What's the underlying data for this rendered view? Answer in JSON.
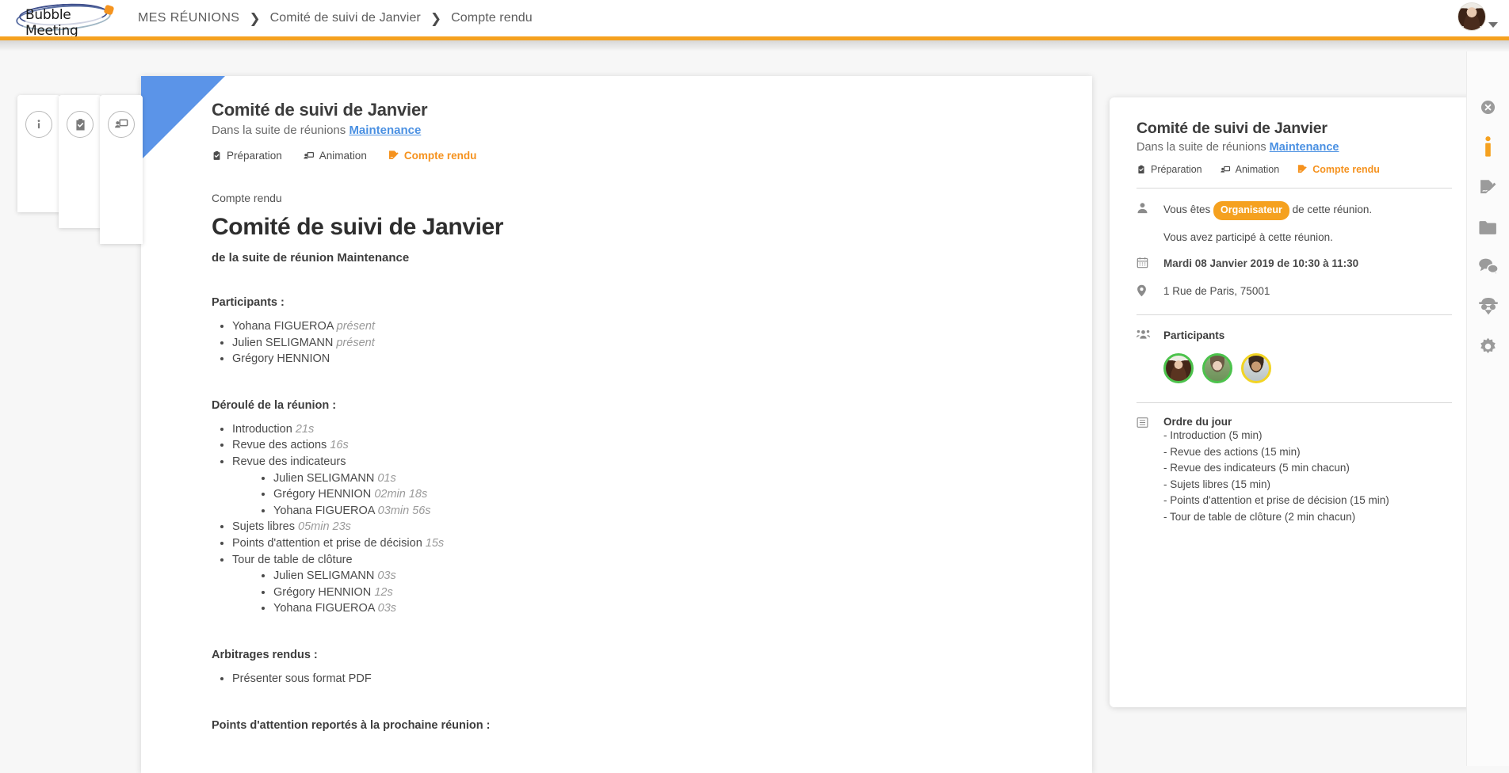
{
  "app": {
    "logo_text": "Bubble Meeting",
    "accent_orange": "#f5a11f",
    "accent_blue": "#4a90e2",
    "corner_blue": "#5b94e8"
  },
  "breadcrumb": {
    "items": [
      {
        "label": "MES RÉUNIONS"
      },
      {
        "label": "Comité de suivi de Janvier"
      },
      {
        "label": "Compte rendu"
      }
    ],
    "separator": "❯"
  },
  "header": {
    "avatar_name": "avatar",
    "caret": "caret-down-icon"
  },
  "left_tabs": [
    {
      "icon": "info-icon",
      "name": "sidebar-tab-info"
    },
    {
      "icon": "clipboard-check-icon",
      "name": "sidebar-tab-preparation"
    },
    {
      "icon": "presentation-icon",
      "name": "sidebar-tab-animation"
    }
  ],
  "document": {
    "card_title": "Comité de suivi de Janvier",
    "card_subtitle_prefix": "Dans la suite de réunions ",
    "card_subtitle_link": "Maintenance",
    "tabs": [
      {
        "label": "Préparation",
        "icon": "clipboard-check-icon",
        "active": false
      },
      {
        "label": "Animation",
        "icon": "presentation-icon",
        "active": false
      },
      {
        "label": "Compte rendu",
        "icon": "report-edit-icon",
        "active": true
      }
    ],
    "kicker": "Compte rendu",
    "title": "Comité de suivi de Janvier",
    "subtitle": "de la suite de réunion Maintenance",
    "sections": {
      "participants_heading": "Participants :",
      "participants": [
        {
          "name": "Yohana FIGUEROA",
          "status": "présent"
        },
        {
          "name": "Julien SELIGMANN",
          "status": "présent"
        },
        {
          "name": "Grégory HENNION",
          "status": ""
        }
      ],
      "deroule_heading": "Déroulé de la réunion :",
      "deroule": [
        {
          "label": "Introduction",
          "time": "21s",
          "children": []
        },
        {
          "label": "Revue des actions",
          "time": "16s",
          "children": []
        },
        {
          "label": "Revue des indicateurs",
          "time": "",
          "children": [
            {
              "label": "Julien SELIGMANN",
              "time": "01s"
            },
            {
              "label": "Grégory HENNION",
              "time": "02min 18s"
            },
            {
              "label": "Yohana FIGUEROA",
              "time": "03min 56s"
            }
          ]
        },
        {
          "label": "Sujets libres",
          "time": "05min 23s",
          "children": []
        },
        {
          "label": "Points d'attention et prise de décision",
          "time": "15s",
          "children": []
        },
        {
          "label": "Tour de table de clôture",
          "time": "",
          "children": [
            {
              "label": "Julien SELIGMANN",
              "time": "03s"
            },
            {
              "label": "Grégory HENNION",
              "time": "12s"
            },
            {
              "label": "Yohana FIGUEROA",
              "time": "03s"
            }
          ]
        }
      ],
      "arbitrages_heading": "Arbitrages rendus :",
      "arbitrages": [
        {
          "label": "Présenter sous format PDF"
        }
      ],
      "points_heading": "Points d'attention reportés à la prochaine réunion :"
    }
  },
  "info_panel": {
    "title": "Comité de suivi de Janvier",
    "subtitle_prefix": "Dans la suite de réunions ",
    "subtitle_link": "Maintenance",
    "tabs": [
      {
        "label": "Préparation",
        "icon": "clipboard-check-icon",
        "active": false
      },
      {
        "label": "Animation",
        "icon": "presentation-icon",
        "active": false
      },
      {
        "label": "Compte rendu",
        "icon": "report-edit-icon",
        "active": true
      }
    ],
    "role_prefix": "Vous êtes ",
    "role_badge": "Organisateur",
    "role_suffix": " de cette réunion.",
    "attendance": "Vous avez participé à cette réunion.",
    "datetime": "Mardi 08 Janvier 2019 de 10:30 à 11:30",
    "location": "1 Rue de Paris, 75001",
    "participants_label": "Participants",
    "participants": [
      {
        "name": "Yohana FIGUEROA",
        "ring": "#4cc24c"
      },
      {
        "name": "Julien SELIGMANN",
        "ring": "#4cc24c"
      },
      {
        "name": "Grégory HENNION",
        "ring": "#f2d424"
      }
    ],
    "agenda_title": "Ordre du jour",
    "agenda": [
      "- Introduction (5 min)",
      "- Revue des actions (15 min)",
      "- Revue des indicateurs (5 min chacun)",
      "- Sujets libres (15 min)",
      "- Points d'attention et prise de décision (15 min)",
      "- Tour de table de clôture (2 min chacun)"
    ]
  },
  "rail": [
    {
      "icon": "close-circle-icon",
      "name": "close-panel-button",
      "active": false
    },
    {
      "icon": "info-icon",
      "name": "rail-info-button",
      "active": true
    },
    {
      "icon": "edit-document-icon",
      "name": "rail-report-button",
      "active": false
    },
    {
      "icon": "folder-icon",
      "name": "rail-documents-button",
      "active": false
    },
    {
      "icon": "chat-icon",
      "name": "rail-discussion-button",
      "active": false
    },
    {
      "icon": "spy-icon",
      "name": "rail-observer-button",
      "active": false
    },
    {
      "icon": "gear-icon",
      "name": "rail-settings-button",
      "active": false
    }
  ]
}
